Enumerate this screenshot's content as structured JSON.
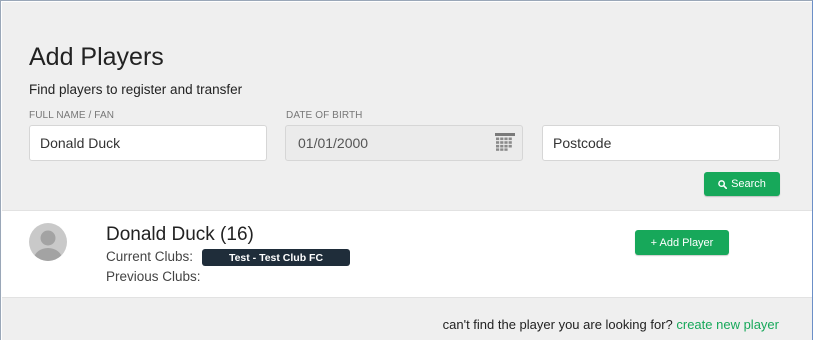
{
  "header": {
    "title": "Add Players",
    "subtitle": "Find players to register and transfer"
  },
  "search": {
    "name_label": "FULL NAME / FAN",
    "name_value": "Donald Duck",
    "dob_label": "DATE OF BIRTH",
    "dob_value": "01/01/2000",
    "postcode_placeholder": "Postcode",
    "search_label": "Search"
  },
  "result": {
    "name": "Donald Duck (16)",
    "current_clubs_label": "Current Clubs:",
    "current_club": "Test - Test Club FC",
    "previous_clubs_label": "Previous Clubs:",
    "add_label": "+ Add Player"
  },
  "footer": {
    "prompt": "can't find the player you are looking for?",
    "link": "create new player"
  },
  "colors": {
    "accent_green": "#17a85a",
    "badge_dark": "#1f2d3a",
    "panel_gray": "#efefef"
  },
  "icons": [
    "calendar-icon",
    "search-icon",
    "avatar-icon"
  ]
}
